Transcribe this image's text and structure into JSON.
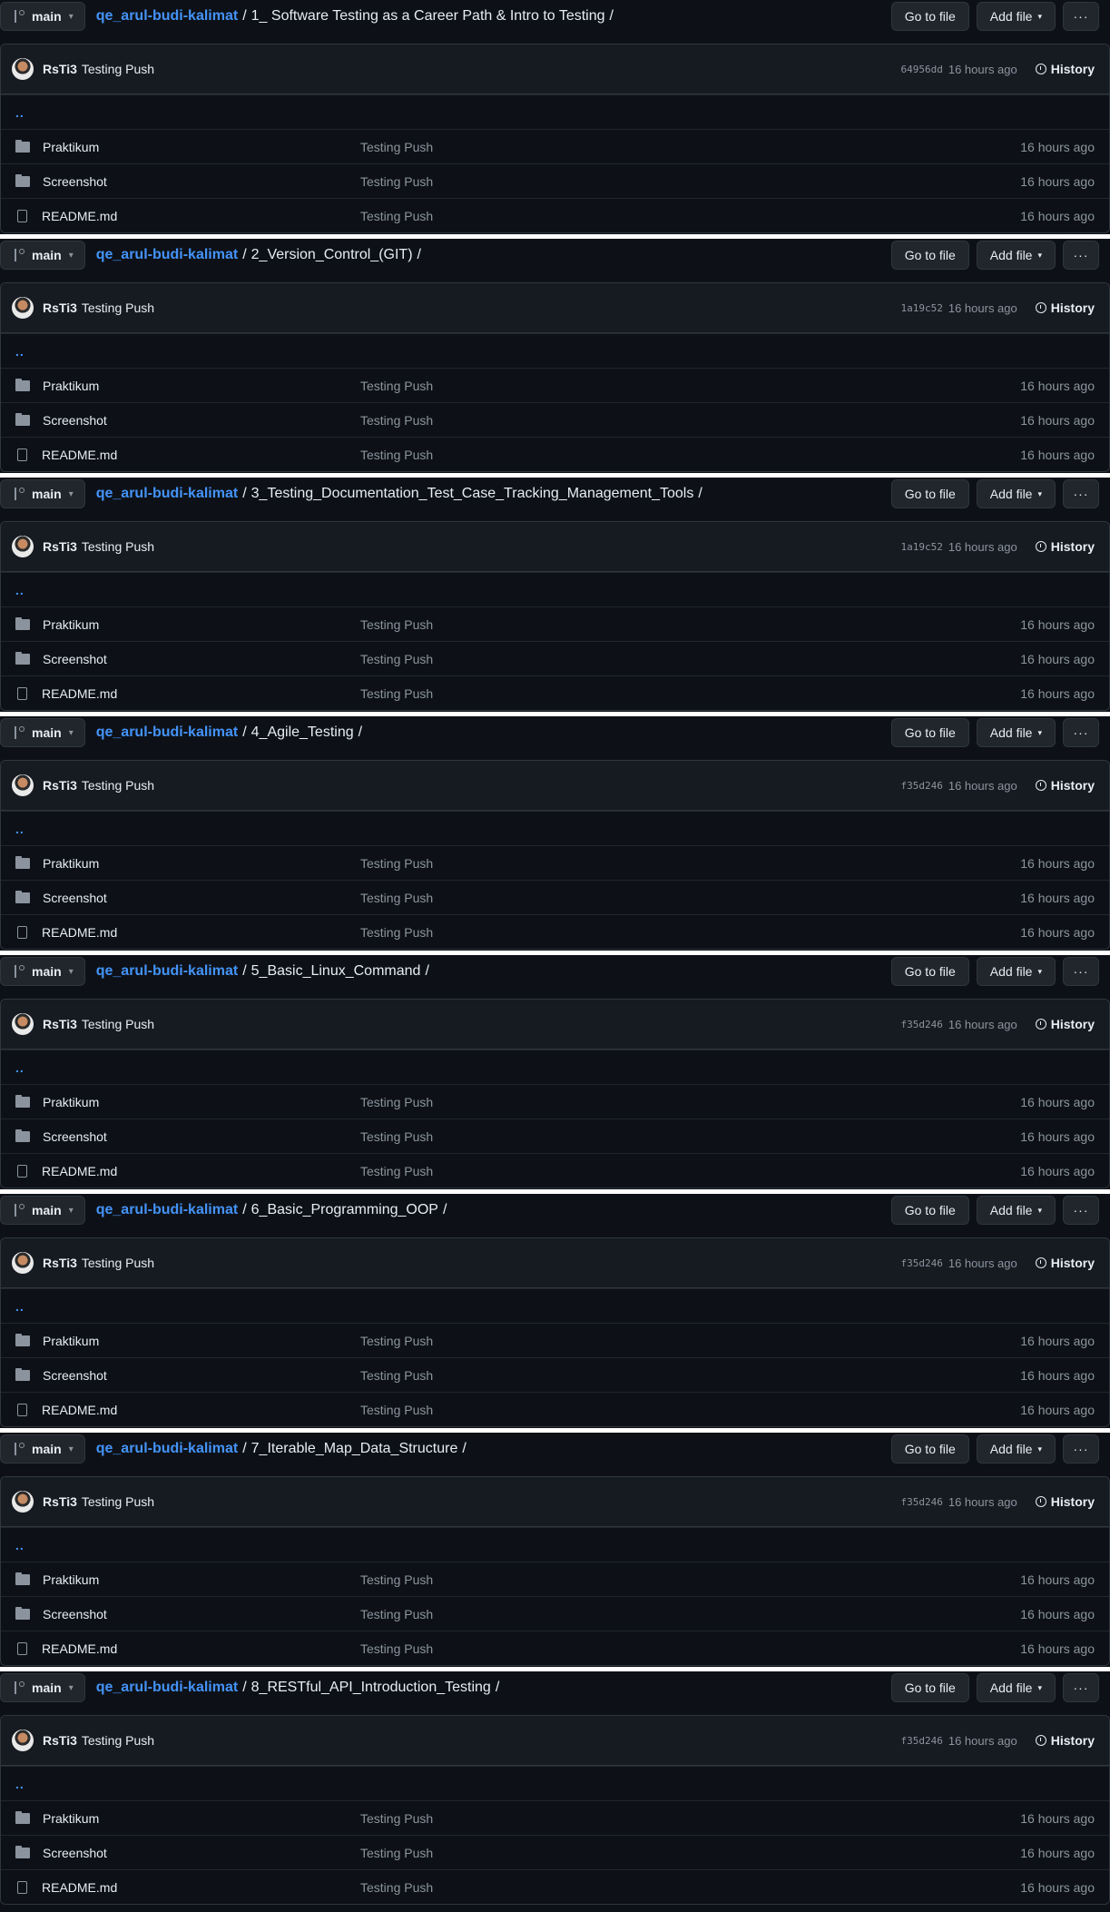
{
  "panels": [
    {
      "branch": "main",
      "repo": "qe_arul-budi-kalimat",
      "dir": "1_ Software Testing as a Career Path & Intro to Testing",
      "author": "RsTi3",
      "message": "Testing Push",
      "sha": "64956dd",
      "time": "16 hours ago"
    },
    {
      "branch": "main",
      "repo": "qe_arul-budi-kalimat",
      "dir": "2_Version_Control_(GIT)",
      "author": "RsTi3",
      "message": "Testing Push",
      "sha": "1a19c52",
      "time": "16 hours ago"
    },
    {
      "branch": "main",
      "repo": "qe_arul-budi-kalimat",
      "dir": "3_Testing_Documentation_Test_Case_Tracking_Management_Tools",
      "author": "RsTi3",
      "message": "Testing Push",
      "sha": "1a19c52",
      "time": "16 hours ago"
    },
    {
      "branch": "main",
      "repo": "qe_arul-budi-kalimat",
      "dir": "4_Agile_Testing",
      "author": "RsTi3",
      "message": "Testing Push",
      "sha": "f35d246",
      "time": "16 hours ago"
    },
    {
      "branch": "main",
      "repo": "qe_arul-budi-kalimat",
      "dir": "5_Basic_Linux_Command",
      "author": "RsTi3",
      "message": "Testing Push",
      "sha": "f35d246",
      "time": "16 hours ago"
    },
    {
      "branch": "main",
      "repo": "qe_arul-budi-kalimat",
      "dir": "6_Basic_Programming_OOP",
      "author": "RsTi3",
      "message": "Testing Push",
      "sha": "f35d246",
      "time": "16 hours ago"
    },
    {
      "branch": "main",
      "repo": "qe_arul-budi-kalimat",
      "dir": "7_Iterable_Map_Data_Structure",
      "author": "RsTi3",
      "message": "Testing Push",
      "sha": "f35d246",
      "time": "16 hours ago"
    },
    {
      "branch": "main",
      "repo": "qe_arul-budi-kalimat",
      "dir": "8_RESTful_API_Introduction_Testing",
      "author": "RsTi3",
      "message": "Testing Push",
      "sha": "f35d246",
      "time": "16 hours ago"
    }
  ],
  "labels": {
    "go_to_file": "Go to file",
    "add_file": "Add file",
    "more": "···",
    "history": "History",
    "up": "..",
    "sep": "/"
  },
  "files": [
    {
      "name": "Praktikum",
      "type": "folder",
      "message": "Testing Push",
      "age": "16 hours ago"
    },
    {
      "name": "Screenshot",
      "type": "folder",
      "message": "Testing Push",
      "age": "16 hours ago"
    },
    {
      "name": "README.md",
      "type": "file",
      "message": "Testing Push",
      "age": "16 hours ago"
    }
  ],
  "colors": {
    "bg": "#0d1117",
    "header": "#161b22",
    "link": "#4493f8",
    "muted": "#8b949e"
  }
}
